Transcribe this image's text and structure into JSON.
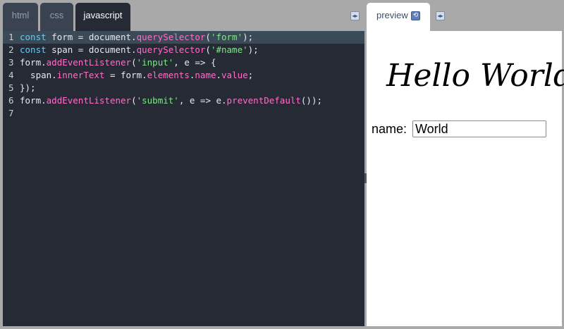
{
  "editor": {
    "tabs": [
      {
        "label": "html"
      },
      {
        "label": "css"
      },
      {
        "label": "javascript"
      }
    ],
    "active_tab": "javascript",
    "collapse_icon": "double-arrow-icon",
    "lines": [
      {
        "n": "1",
        "tokens": [
          {
            "t": "const",
            "k": "kw"
          },
          {
            "t": " form = document.",
            "k": "pl"
          },
          {
            "t": "querySelector",
            "k": "fn"
          },
          {
            "t": "(",
            "k": "pl"
          },
          {
            "t": "'form'",
            "k": "str"
          },
          {
            "t": ");",
            "k": "pl"
          }
        ]
      },
      {
        "n": "2",
        "tokens": [
          {
            "t": "const",
            "k": "kw"
          },
          {
            "t": " span = document.",
            "k": "pl"
          },
          {
            "t": "querySelector",
            "k": "fn"
          },
          {
            "t": "(",
            "k": "pl"
          },
          {
            "t": "'#name'",
            "k": "str"
          },
          {
            "t": ");",
            "k": "pl"
          }
        ]
      },
      {
        "n": "3",
        "tokens": [
          {
            "t": "form.",
            "k": "pl"
          },
          {
            "t": "addEventListener",
            "k": "fn"
          },
          {
            "t": "(",
            "k": "pl"
          },
          {
            "t": "'input'",
            "k": "str"
          },
          {
            "t": ", e => {",
            "k": "pl"
          }
        ]
      },
      {
        "n": "4",
        "tokens": [
          {
            "t": "  span.",
            "k": "pl"
          },
          {
            "t": "innerText",
            "k": "fn"
          },
          {
            "t": " = form.",
            "k": "pl"
          },
          {
            "t": "elements",
            "k": "fn"
          },
          {
            "t": ".",
            "k": "pl"
          },
          {
            "t": "name",
            "k": "fn"
          },
          {
            "t": ".",
            "k": "pl"
          },
          {
            "t": "value",
            "k": "fn"
          },
          {
            "t": ";",
            "k": "pl"
          }
        ]
      },
      {
        "n": "5",
        "tokens": [
          {
            "t": "});",
            "k": "pl"
          }
        ]
      },
      {
        "n": "6",
        "tokens": [
          {
            "t": "form.",
            "k": "pl"
          },
          {
            "t": "addEventListener",
            "k": "fn"
          },
          {
            "t": "(",
            "k": "pl"
          },
          {
            "t": "'submit'",
            "k": "str"
          },
          {
            "t": ", e => e.",
            "k": "pl"
          },
          {
            "t": "preventDefault",
            "k": "fn"
          },
          {
            "t": "());",
            "k": "pl"
          }
        ]
      },
      {
        "n": "7",
        "tokens": []
      }
    ],
    "active_line": "1"
  },
  "preview": {
    "tab_label": "preview",
    "refresh_icon": "refresh-icon",
    "heading": "Hello World",
    "form": {
      "label": "name:",
      "value": "World"
    }
  },
  "colors": {
    "background": "#a9a9a9",
    "editor_bg": "#262a34",
    "keyword": "#6cc8f2",
    "function": "#ff6ec7",
    "string": "#7ee787"
  }
}
